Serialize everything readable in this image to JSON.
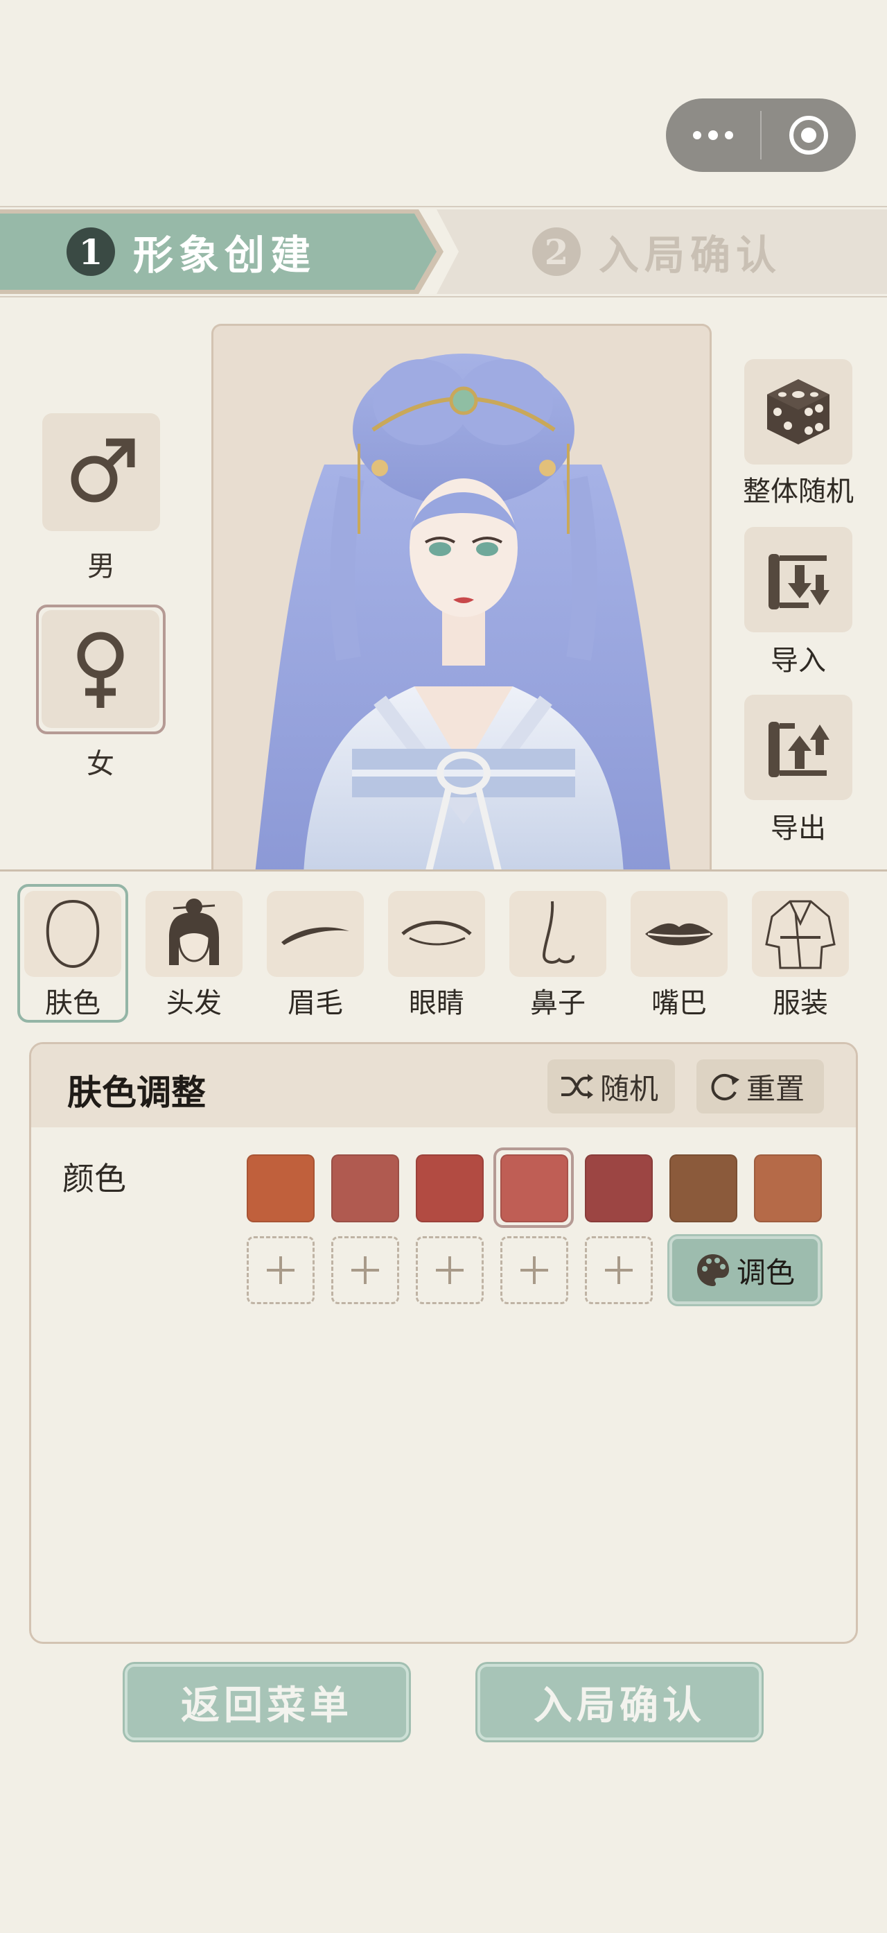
{
  "capsule": {
    "menu_icon": "more-dots-icon",
    "close_icon": "target-circle-icon"
  },
  "steps": [
    {
      "num": "1",
      "label": "形象创建"
    },
    {
      "num": "2",
      "label": "入局确认"
    }
  ],
  "gender": {
    "male": "男",
    "female": "女"
  },
  "actions": {
    "random_all": "整体随机",
    "import": "导入",
    "export": "导出"
  },
  "tabs": [
    {
      "label": "肤色",
      "icon": "face-outline-icon"
    },
    {
      "label": "头发",
      "icon": "hair-bun-icon"
    },
    {
      "label": "眉毛",
      "icon": "eyebrow-icon"
    },
    {
      "label": "眼睛",
      "icon": "eye-icon"
    },
    {
      "label": "鼻子",
      "icon": "nose-icon"
    },
    {
      "label": "嘴巴",
      "icon": "lips-icon"
    },
    {
      "label": "服装",
      "icon": "robe-icon"
    }
  ],
  "panel": {
    "title": "肤色调整",
    "random_label": "随机",
    "reset_label": "重置",
    "color_label": "颜色",
    "swatches": [
      "#c0603c",
      "#b05a50",
      "#b24b42",
      "#bf5e55",
      "#9c4543",
      "#8b5a3b",
      "#b56a48"
    ],
    "selected_index": 3,
    "add_slots": 5,
    "mix_label": "调色"
  },
  "footer": {
    "back_label": "返回菜单",
    "confirm_label": "入局确认"
  }
}
